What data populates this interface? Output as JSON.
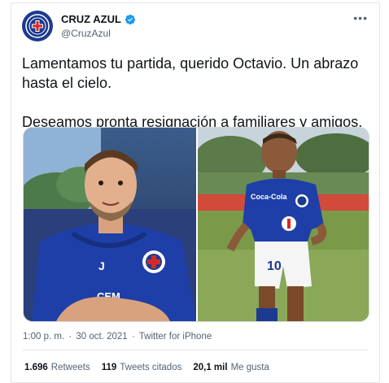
{
  "tweet": {
    "display_name": "CRUZ AZUL",
    "handle": "@CruzAzul",
    "more_icon": "more-horizontal-icon",
    "verified_icon": "verified-badge-icon",
    "text": "Lamentamos tu partida, querido Octavio. Un abrazo\nhasta el cielo.\n\nDeseamos pronta resignación a familiares y amigos.",
    "time": "1:00 p. m.",
    "separator": "·",
    "date": "30 oct. 2021",
    "source": "Twitter for iPhone"
  },
  "stats": {
    "retweets_count": "1.696",
    "retweets_label": "Retweets",
    "quotes_count": "119",
    "quotes_label": "Tweets citados",
    "likes_count": "20,1 mil",
    "likes_label": "Me gusta"
  },
  "colors": {
    "brand_blue": "#1c3a8f",
    "verified_blue": "#1d9bf0",
    "muted_text": "#536471"
  }
}
